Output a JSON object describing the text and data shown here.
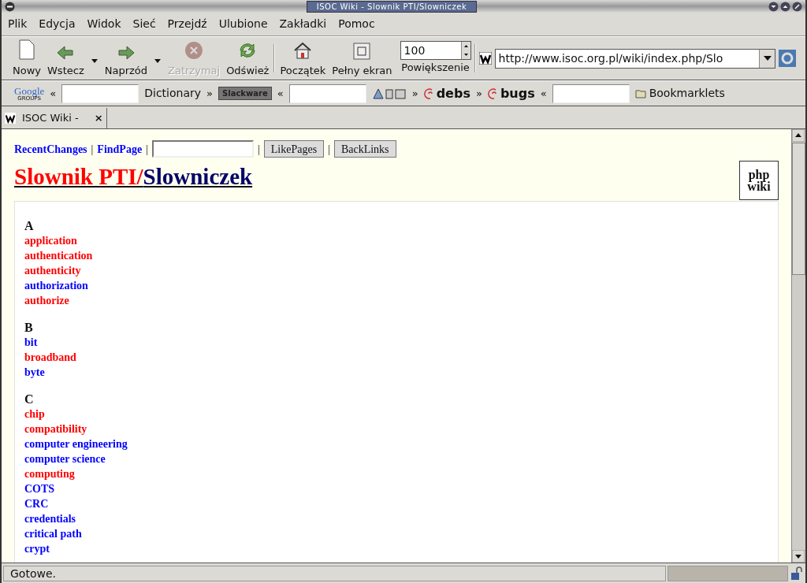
{
  "window": {
    "title": "ISOC Wiki - Slownik PTI/Slowniczek"
  },
  "menu": [
    "Plik",
    "Edycja",
    "Widok",
    "Sieć",
    "Przejdź",
    "Ulubione",
    "Zakładki",
    "Pomoc"
  ],
  "toolbar": [
    {
      "kind": "new",
      "label": "Nowy",
      "disabled": false
    },
    {
      "kind": "back",
      "label": "Wstecz",
      "disabled": false
    },
    {
      "kind": "dropdown"
    },
    {
      "kind": "forward",
      "label": "Naprzód",
      "disabled": false
    },
    {
      "kind": "dropdown"
    },
    {
      "kind": "stop",
      "label": "Zatrzymaj",
      "disabled": true
    },
    {
      "kind": "reload",
      "label": "Odśwież",
      "disabled": false
    },
    {
      "kind": "home",
      "label": "Początek",
      "disabled": false
    },
    {
      "kind": "fullscreen",
      "label": "Pełny ekran",
      "disabled": false
    }
  ],
  "zoom": {
    "value": "100",
    "label": "Powiększenie"
  },
  "url": "http://www.isoc.org.pl/wiki/index.php/Slo",
  "personal_bar": [
    {
      "kind": "logo",
      "text": "Google",
      "subtext": "GROUPS"
    },
    {
      "kind": "sep",
      "text": "«"
    },
    {
      "kind": "field"
    },
    {
      "kind": "link",
      "text": "Dictionary"
    },
    {
      "kind": "sep",
      "text": "»"
    },
    {
      "kind": "badge",
      "text": "Slackware"
    },
    {
      "kind": "sep",
      "text": "«"
    },
    {
      "kind": "field"
    },
    {
      "kind": "glyph"
    },
    {
      "kind": "sep",
      "text": "»"
    },
    {
      "kind": "debian",
      "text": "debs"
    },
    {
      "kind": "sep",
      "text": "»"
    },
    {
      "kind": "debian",
      "text": "bugs"
    },
    {
      "kind": "sep",
      "text": "«"
    },
    {
      "kind": "field"
    },
    {
      "kind": "folder",
      "text": "Bookmarklets"
    }
  ],
  "tab": {
    "title": "ISOC Wiki -",
    "close": "×"
  },
  "page": {
    "nav": [
      {
        "kind": "link",
        "text": "RecentChanges"
      },
      {
        "kind": "sep",
        "text": "|"
      },
      {
        "kind": "link",
        "text": "FindPage"
      },
      {
        "kind": "sep",
        "text": "|"
      },
      {
        "kind": "field"
      },
      {
        "kind": "sep",
        "text": "|"
      },
      {
        "kind": "button",
        "text": "LikePages"
      },
      {
        "kind": "sep",
        "text": "|"
      },
      {
        "kind": "button",
        "text": "BackLinks"
      }
    ],
    "title_parent": "Slownik PTI/",
    "title_page": "Slowniczek",
    "logo": [
      "php",
      "wiki"
    ],
    "sections": [
      {
        "letter": "A",
        "terms": [
          {
            "text": "application",
            "color": "#ff0000"
          },
          {
            "text": "authentication",
            "color": "#ff0000"
          },
          {
            "text": "authenticity",
            "color": "#ff0000"
          },
          {
            "text": "authorization",
            "color": "#0000ff"
          },
          {
            "text": "authorize",
            "color": "#ff0000"
          }
        ]
      },
      {
        "letter": "B",
        "terms": [
          {
            "text": "bit",
            "color": "#0000ff"
          },
          {
            "text": "broadband",
            "color": "#ff0000"
          },
          {
            "text": "byte",
            "color": "#0000ff"
          }
        ]
      },
      {
        "letter": "C",
        "terms": [
          {
            "text": "chip",
            "color": "#ff0000"
          },
          {
            "text": "compatibility",
            "color": "#ff0000"
          },
          {
            "text": "computer engineering",
            "color": "#0000ff"
          },
          {
            "text": "computer science",
            "color": "#0000ff"
          },
          {
            "text": "computing",
            "color": "#ff0000"
          },
          {
            "text": "COTS",
            "color": "#0000ff"
          },
          {
            "text": "CRC",
            "color": "#0000ff"
          },
          {
            "text": "credentials",
            "color": "#0000ff"
          },
          {
            "text": "critical path",
            "color": "#0000ff"
          },
          {
            "text": "crypt",
            "color": "#0000ff"
          }
        ]
      }
    ]
  },
  "status": "Gotowe."
}
